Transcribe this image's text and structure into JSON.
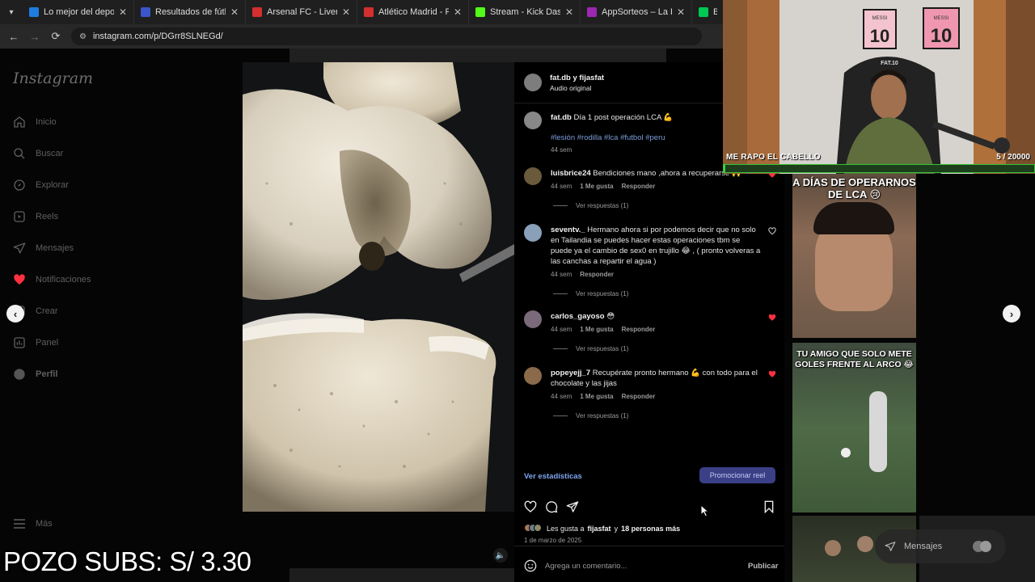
{
  "browser": {
    "tabs": [
      {
        "title": "Lo mejor del deporte y el",
        "color": "#1f7de0"
      },
      {
        "title": "Resultados de fútbol en d",
        "color": "#3a56c8"
      },
      {
        "title": "Arsenal FC - Liverpool FC",
        "color": "#d32f2f"
      },
      {
        "title": "Atlético Madrid - Real Ma",
        "color": "#d32f2f"
      },
      {
        "title": "Stream - Kick Dashboard",
        "color": "#53fc18"
      },
      {
        "title": "AppSorteos – La Ruleta d",
        "color": "#9c27b0"
      },
      {
        "title": "BAN",
        "color": "#00c853"
      }
    ],
    "url": "instagram.com/p/DGrr8SLNEGd/"
  },
  "sidebar": {
    "logo": "Instagram",
    "items": [
      {
        "label": "Inicio",
        "icon": "home-icon"
      },
      {
        "label": "Buscar",
        "icon": "search-icon"
      },
      {
        "label": "Explorar",
        "icon": "compass-icon"
      },
      {
        "label": "Reels",
        "icon": "reels-icon"
      },
      {
        "label": "Mensajes",
        "icon": "messenger-icon"
      },
      {
        "label": "Notificaciones",
        "icon": "heart-icon"
      },
      {
        "label": "Crear",
        "icon": "plus-square-icon"
      },
      {
        "label": "Panel",
        "icon": "dashboard-icon"
      },
      {
        "label": "Perfil",
        "icon": "profile-avatar"
      }
    ],
    "more": "Más"
  },
  "post": {
    "header_user": "fat.db y fijasfat",
    "header_sub": "Audio original",
    "caption_user": "fat.db",
    "caption_text": "Día 1 post operación LCA 💪",
    "caption_tags": "#lesión #rodilla #lca #futbol #peru",
    "caption_time": "44 sem",
    "comments": [
      {
        "user": "luisbrice24",
        "text": "Bendiciones mano ,ahora a recuperarse 🙌",
        "time": "44 sem",
        "likes": "1 Me gusta",
        "reply": "Responder",
        "view": "Ver respuestas (1)",
        "liked": true
      },
      {
        "user": "seventv._",
        "text": "Hermano ahora si por podemos decir que no solo en Tailandia se puedes hacer estas operaciones tbm se puede ya el cambio de sex0 en trujillo 😂 , ( pronto volveras a las canchas a repartir el agua )",
        "time": "44 sem",
        "likes": "",
        "reply": "Responder",
        "view": "Ver respuestas (1)",
        "liked": false
      },
      {
        "user": "carlos_gayoso",
        "text": "😳",
        "time": "44 sem",
        "likes": "1 Me gusta",
        "reply": "Responder",
        "view": "Ver respuestas (1)",
        "liked": true
      },
      {
        "user": "popeyejj_7",
        "text": "Recupérate pronto hermano 💪 con todo para el chocolate y las jijas",
        "time": "44 sem",
        "likes": "1 Me gusta",
        "reply": "Responder",
        "view": "Ver respuestas (1)",
        "liked": true
      }
    ],
    "stats_link": "Ver estadísticas",
    "promote_button": "Promocionar reel",
    "likes_prefix": "Les gusta a",
    "likes_user": "fijasfat",
    "likes_mid": "y",
    "likes_others": "18 personas más",
    "date": "1 de marzo de 2025",
    "comment_placeholder": "Agrega un comentario...",
    "publish": "Publicar"
  },
  "grid": {
    "thumb1_text": "A DÍAS DE OPERARNOS DE LCA 😢",
    "thumb2_text": "TU AMIGO QUE SOLO METE GOLES FRENTE AL ARCO 😂"
  },
  "messages_pill": "Mensajes",
  "overlay": {
    "cam_label": "ME RAPO EL CABELLO",
    "cam_count": "5  / 20000",
    "goal_progress": 0.00025,
    "subs_text": "POZO SUBS: S/ 3.30",
    "jersey_top": "MESSI",
    "jersey_number": "10",
    "shirt_text": "FAT.10"
  },
  "colors": {
    "accent": "#3a3f86",
    "link": "#7da6f0",
    "like_red": "#ff3040",
    "progress_green": "#3fd43f"
  }
}
